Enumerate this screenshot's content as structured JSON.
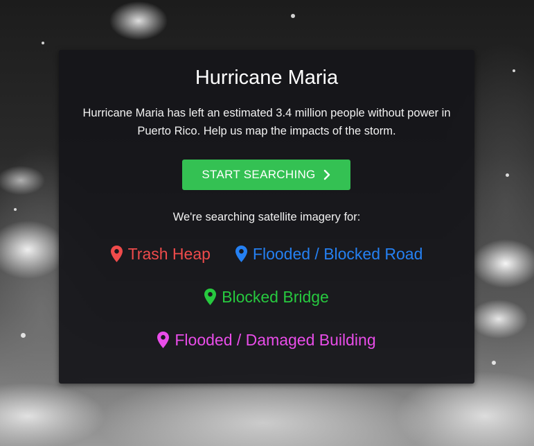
{
  "panel": {
    "title": "Hurricane Maria",
    "description": "Hurricane Maria has left an estimated 3.4 million people without power in Puerto Rico. Help us map the impacts of the storm.",
    "start_button_label": "START SEARCHING",
    "searching_for_label": "We're searching satellite imagery for:"
  },
  "targets": [
    {
      "label": "Trash Heap",
      "color": "#ef4b4b",
      "icon": "map-pin-icon"
    },
    {
      "label": "Flooded / Blocked Road",
      "color": "#2580f2",
      "icon": "map-pin-icon"
    },
    {
      "label": "Blocked Bridge",
      "color": "#27c93f",
      "icon": "map-pin-icon"
    },
    {
      "label": "Flooded / Damaged Building",
      "color": "#e94de9",
      "icon": "map-pin-icon"
    }
  ],
  "colors": {
    "button": "#34c153",
    "panel_background": "#16161a"
  }
}
